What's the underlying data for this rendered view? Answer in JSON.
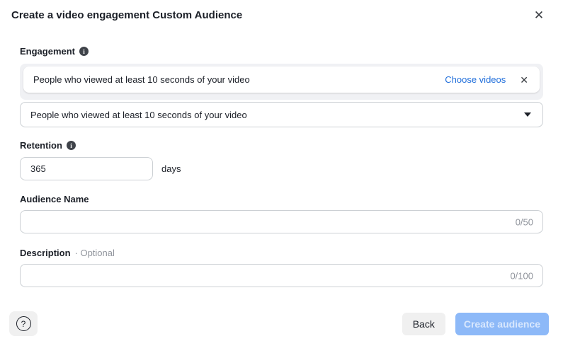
{
  "dialog": {
    "title": "Create a video engagement Custom Audience"
  },
  "icons": {
    "close": "✕",
    "remove": "✕",
    "info": "i",
    "help": "?"
  },
  "engagement": {
    "label": "Engagement",
    "selected_card": {
      "text": "People who viewed at least 10 seconds of your video",
      "action_label": "Choose videos"
    },
    "dropdown": {
      "value": "People who viewed at least 10 seconds of your video"
    }
  },
  "retention": {
    "label": "Retention",
    "value": "365",
    "unit": "days"
  },
  "audience_name": {
    "label": "Audience Name",
    "value": "",
    "counter": "0/50"
  },
  "description": {
    "label": "Description",
    "optional": "· Optional",
    "value": "",
    "counter": "0/100"
  },
  "footer": {
    "back_label": "Back",
    "create_label": "Create audience"
  },
  "colors": {
    "link_blue": "#216fdb",
    "disabled_primary": "#8db9f8",
    "text_dark": "#1c2028",
    "text_gray": "#90949c",
    "border_gray": "#ccd0d4",
    "container_gray": "#f0f1f4",
    "button_gray": "#f0f0f0"
  }
}
